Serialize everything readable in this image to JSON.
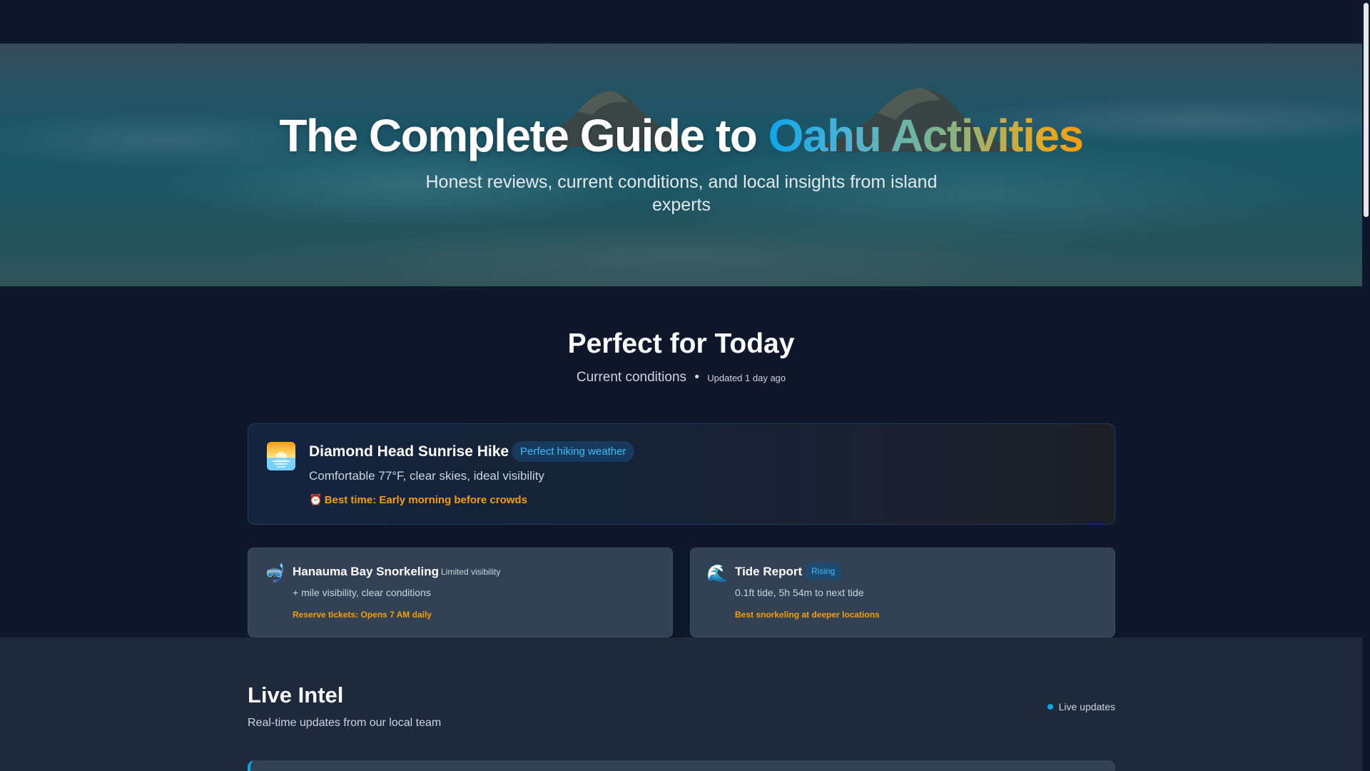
{
  "hero": {
    "title_main": "The Complete Guide to ",
    "title_accent": "Oahu Activities",
    "subtitle": "Honest reviews, current conditions, and local insights from island experts"
  },
  "today": {
    "title": "Perfect for Today",
    "subtitle": "Current conditions",
    "separator": "•",
    "updated": "Updated 1 day ago",
    "featured": {
      "icon": "sunrise-icon",
      "title": "Diamond Head Sunrise Hike",
      "badge": "Perfect hiking weather",
      "description": "Comfortable 77°F, clear skies, ideal visibility",
      "tip_icon": "⏰",
      "tip": "Best time: Early morning before crowds"
    },
    "cards": [
      {
        "icon": "🤿",
        "icon_name": "snorkel-mask-icon",
        "title": "Hanauma Bay Snorkeling",
        "tag": "Limited visibility",
        "description": "+ mile visibility, clear conditions",
        "tip": "Reserve tickets: Opens 7 AM daily"
      },
      {
        "icon": "🌊",
        "icon_name": "wave-icon",
        "title": "Tide Report",
        "tag": "Rising",
        "description": "0.1ft tide, 5h 54m to next tide",
        "tip": "Best snorkeling at deeper locations"
      }
    ]
  },
  "live": {
    "title": "Live Intel",
    "subtitle": "Real-time updates from our local team",
    "status": "Live updates"
  },
  "colors": {
    "background": "#0f172a",
    "accent_blue": "#0ea5e9",
    "accent_amber": "#f59e0b",
    "card": "#334155"
  }
}
